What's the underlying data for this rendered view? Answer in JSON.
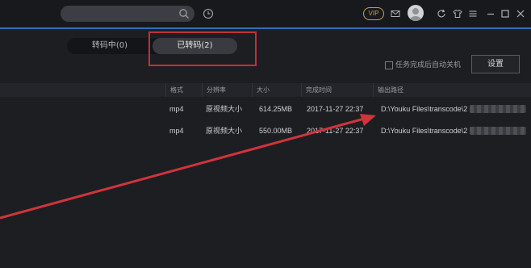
{
  "titlebar": {
    "search": {
      "placeholder": ""
    },
    "vip_label": "VIP",
    "icons": [
      "search-icon",
      "history-clock-icon",
      "mail-icon",
      "avatar",
      "refresh-icon",
      "skin-shirt-icon",
      "menu-icon",
      "minimize-icon",
      "maximize-icon",
      "close-icon"
    ]
  },
  "tabs": [
    {
      "label": "转码中(0)",
      "active": false
    },
    {
      "label": "已转码(2)",
      "active": true
    }
  ],
  "options": {
    "auto_shutdown_label": "任务完成后自动关机",
    "auto_shutdown_checked": false,
    "settings_button": "设置"
  },
  "table": {
    "columns": [
      "格式",
      "分辨率",
      "大小",
      "完成时间",
      "输出路径"
    ],
    "rows": [
      {
        "format": "mp4",
        "resolution": "原视频大小",
        "size": "614.25MB",
        "finished": "2017-11-27 22:37",
        "path": "D:\\Youku Files\\transcode\\2"
      },
      {
        "format": "mp4",
        "resolution": "原视频大小",
        "size": "550.00MB",
        "finished": "2017-11-27 22:37",
        "path": "D:\\Youku Files\\transcode\\2"
      }
    ]
  },
  "colors": {
    "accent_blue": "#2e6fb8",
    "annotation_red": "#c2303a",
    "vip_gold": "#c9a24a"
  }
}
